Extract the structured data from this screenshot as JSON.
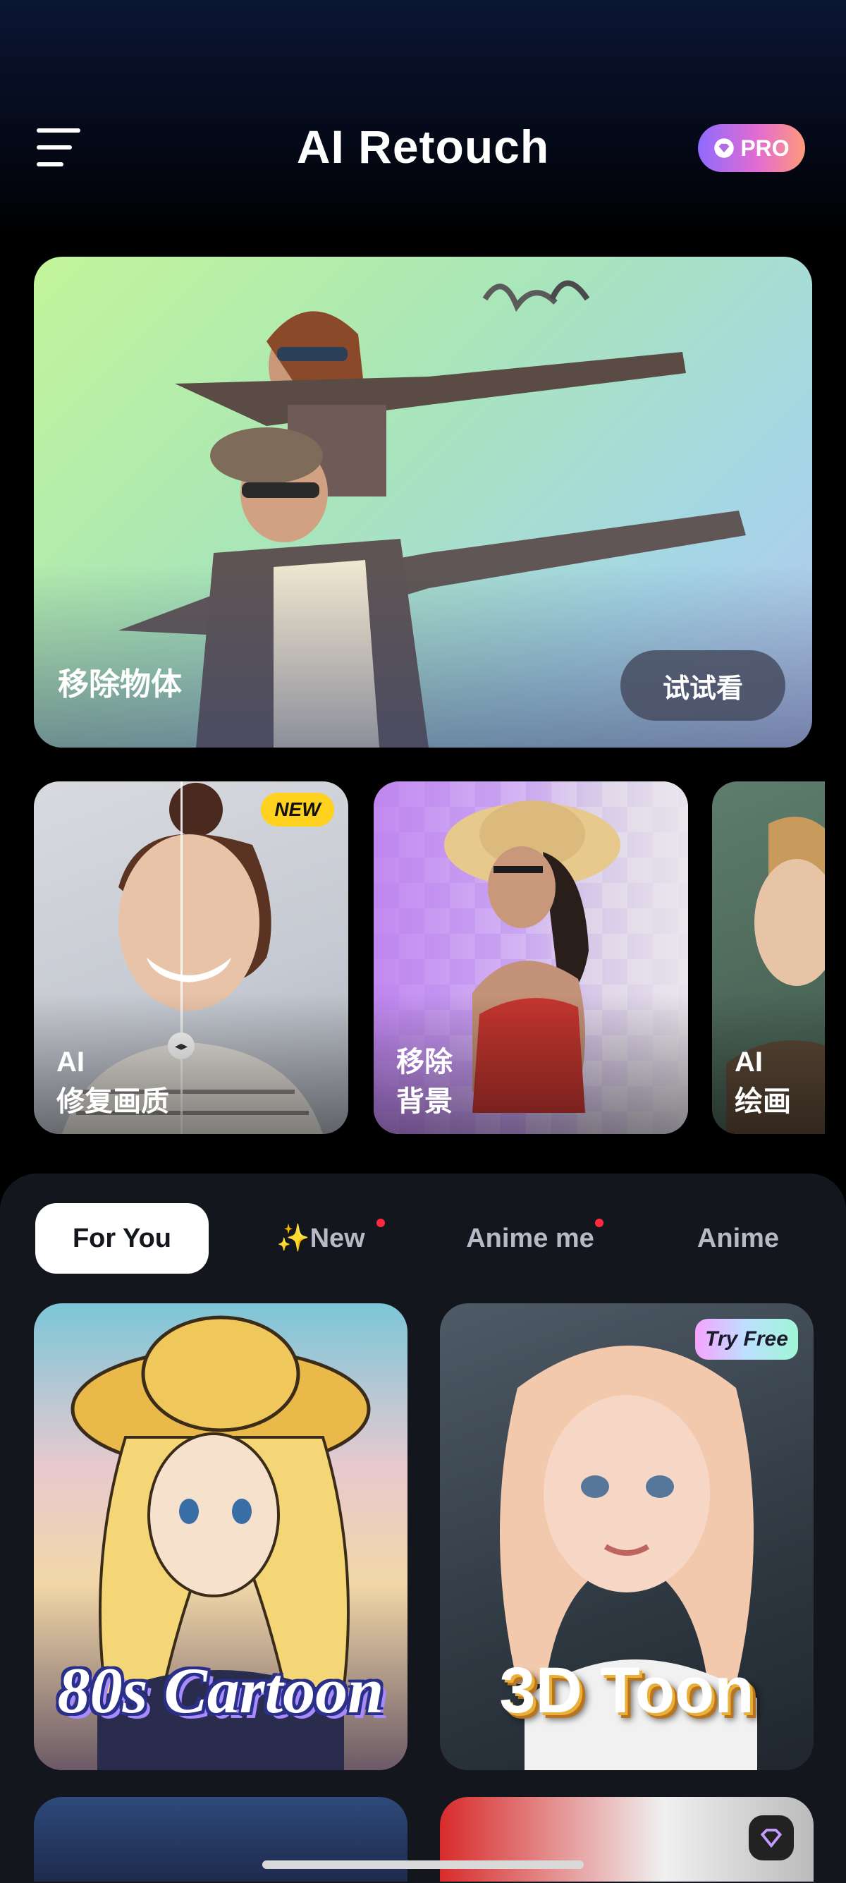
{
  "header": {
    "title": "AI Retouch",
    "pro_label": "PRO"
  },
  "hero": {
    "label": "移除物体",
    "cta": "试试看"
  },
  "tools": [
    {
      "line1": "AI",
      "line2": "修复画质",
      "badge": "NEW"
    },
    {
      "line1": "移除",
      "line2": "背景"
    },
    {
      "line1": "AI",
      "line2": "绘画"
    }
  ],
  "tabs": [
    {
      "label": "For You",
      "active": true
    },
    {
      "label": "✨New",
      "dot": true
    },
    {
      "label": "Anime me",
      "dot": true
    },
    {
      "label": "Anime"
    }
  ],
  "styles": [
    {
      "title": "80s Cartoon"
    },
    {
      "title": "3D Toon",
      "badge": "Try Free"
    }
  ],
  "colors": {
    "accent_red_dot": "#ff2a3d",
    "new_badge": "#ffd21f",
    "panel_bg": "#14161e"
  }
}
